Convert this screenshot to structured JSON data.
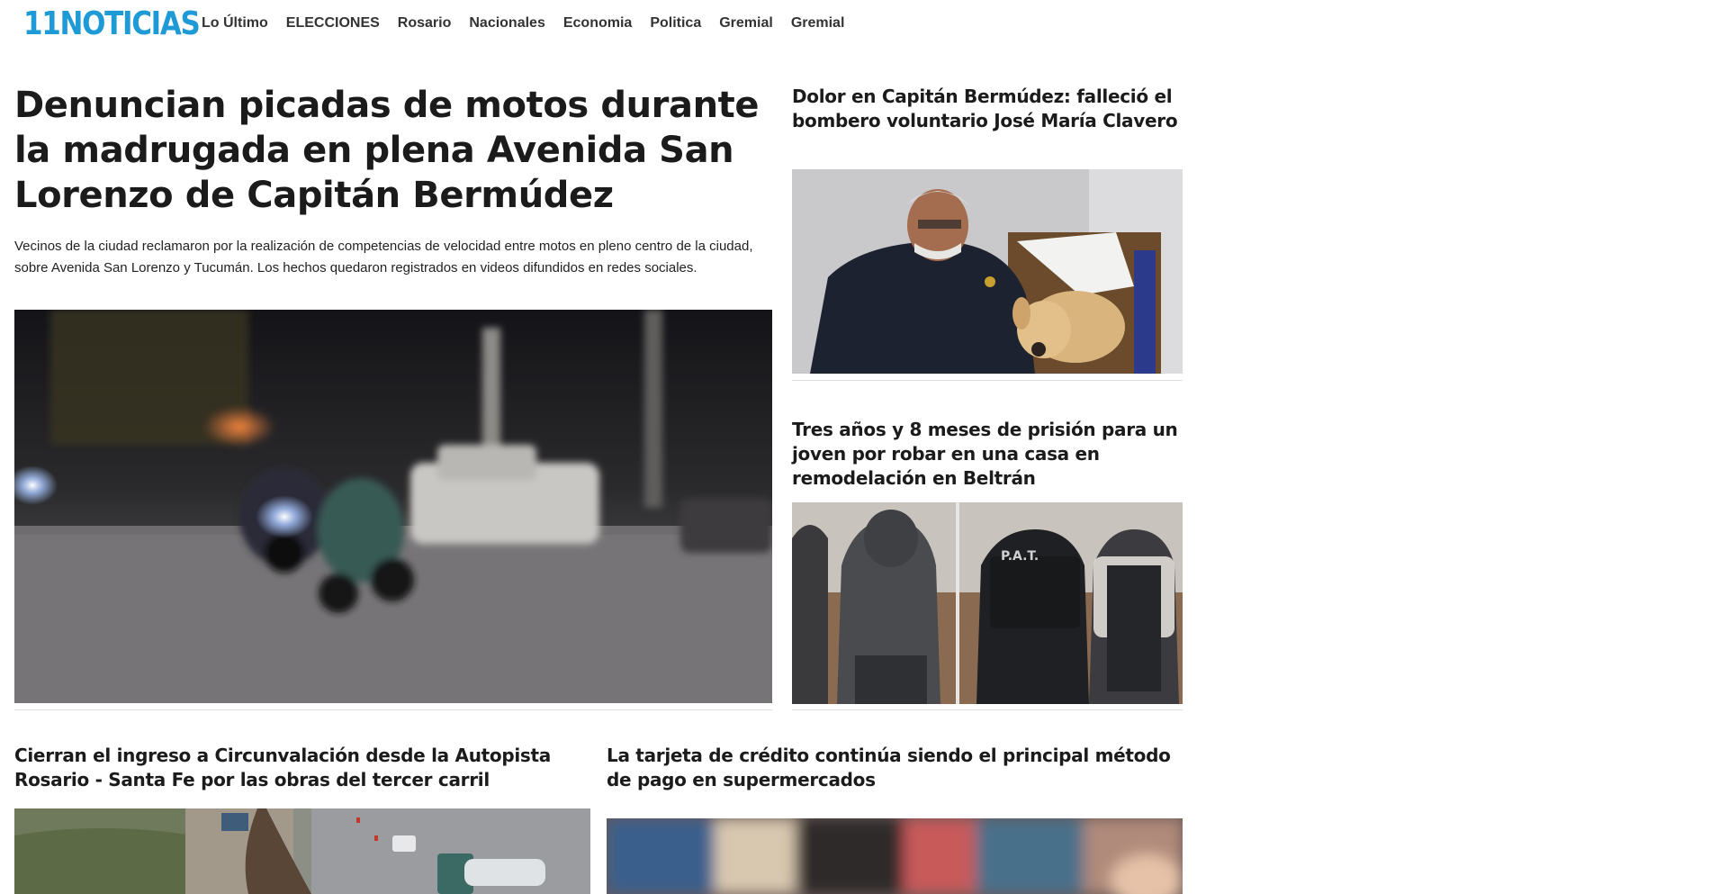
{
  "site": {
    "logo": "11NOTICIAS"
  },
  "nav": [
    "Lo Último",
    "ELECCIONES",
    "Rosario",
    "Nacionales",
    "Economia",
    "Politica",
    "Gremial",
    "Gremial"
  ],
  "lead": {
    "title": "Denuncian picadas de motos durante la madrugada en plena Avenida San Lorenzo de Capitán Bermúdez",
    "summary": "Vecinos de la ciudad reclamaron por la realización de competencias de velocidad entre motos en pleno centro de la ciudad, sobre Avenida San Lorenzo y Tucumán. Los hechos quedaron registrados en videos difundidos en redes sociales."
  },
  "side": [
    {
      "title": "Dolor en Capitán Bermúdez: falleció el bombero voluntario José María Clavero"
    },
    {
      "title": "Tres años y 8 meses de prisión para un joven por robar en una casa en remodelación en Beltrán"
    }
  ],
  "bottom": [
    {
      "title": "Cierran el ingreso a Circunvalación desde la Autopista Rosario - Santa Fe por las obras del tercer carril"
    },
    {
      "title": "La tarjeta de crédito continúa siendo el principal método de pago en supermercados"
    }
  ],
  "colors": {
    "brand": "#1e9ad6",
    "text": "#1b1b1b",
    "nav": "#333333",
    "rule": "#dddddd"
  }
}
